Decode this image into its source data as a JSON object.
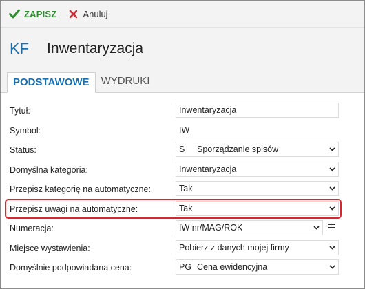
{
  "toolbar": {
    "save_label": "ZAPISZ",
    "cancel_label": "Anuluj"
  },
  "header": {
    "badge": "KF",
    "title": "Inwentaryzacja"
  },
  "tabs": [
    {
      "label": "PODSTAWOWE",
      "active": true
    },
    {
      "label": "WYDRUKI",
      "active": false
    }
  ],
  "form": {
    "title": {
      "label": "Tytuł:",
      "value": "Inwentaryzacja"
    },
    "symbol": {
      "label": "Symbol:",
      "value": "IW"
    },
    "status": {
      "label": "Status:",
      "code": "S",
      "value": "Sporządzanie spisów"
    },
    "default_category": {
      "label": "Domyślna kategoria:",
      "value": "Inwentaryzacja"
    },
    "copy_category": {
      "label": "Przepisz kategorię na automatyczne:",
      "value": "Tak"
    },
    "copy_notes": {
      "label": "Przepisz uwagi na automatyczne:",
      "value": "Tak"
    },
    "numbering": {
      "label": "Numeracja:",
      "value": "IW nr/MAG/ROK"
    },
    "issue_place": {
      "label": "Miejsce wystawienia:",
      "value": "Pobierz z danych mojej firmy"
    },
    "default_price": {
      "label": "Domyślnie podpowiadana cena:",
      "code": "PG",
      "value": "Cena ewidencyjna"
    }
  },
  "colors": {
    "accent": "#1a6fb0",
    "save_green": "#2e8b2e",
    "cancel_red": "#d9262e",
    "highlight_red": "#d9262e"
  }
}
